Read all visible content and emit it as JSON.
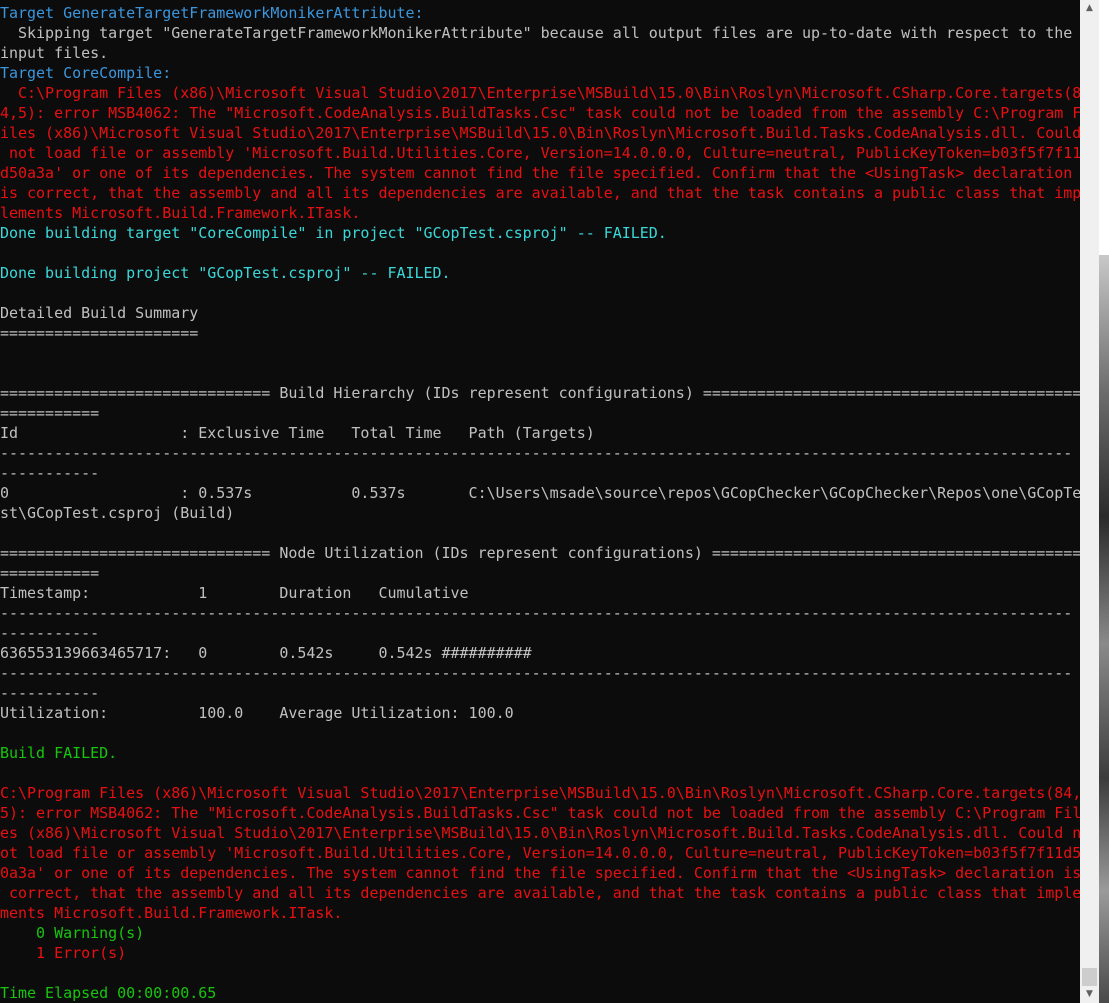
{
  "console": {
    "lines": [
      {
        "text": "Target GenerateTargetFrameworkMonikerAttribute:",
        "color": "#3a96dd"
      },
      {
        "text": "  Skipping target \"GenerateTargetFrameworkMonikerAttribute\" because all output files are up-to-date with respect to the",
        "color": "#c0c0c0"
      },
      {
        "text": "input files.",
        "color": "#c0c0c0"
      },
      {
        "text": "Target CoreCompile:",
        "color": "#3a96dd"
      },
      {
        "text": "  C:\\Program Files (x86)\\Microsoft Visual Studio\\2017\\Enterprise\\MSBuild\\15.0\\Bin\\Roslyn\\Microsoft.CSharp.Core.targets(8",
        "color": "#e81010"
      },
      {
        "text": "4,5): error MSB4062: The \"Microsoft.CodeAnalysis.BuildTasks.Csc\" task could not be loaded from the assembly C:\\Program F",
        "color": "#e81010"
      },
      {
        "text": "iles (x86)\\Microsoft Visual Studio\\2017\\Enterprise\\MSBuild\\15.0\\Bin\\Roslyn\\Microsoft.Build.Tasks.CodeAnalysis.dll. Could",
        "color": "#e81010"
      },
      {
        "text": " not load file or assembly 'Microsoft.Build.Utilities.Core, Version=14.0.0.0, Culture=neutral, PublicKeyToken=b03f5f7f11",
        "color": "#e81010"
      },
      {
        "text": "d50a3a' or one of its dependencies. The system cannot find the file specified. Confirm that the <UsingTask> declaration",
        "color": "#e81010"
      },
      {
        "text": "is correct, that the assembly and all its dependencies are available, and that the task contains a public class that imp",
        "color": "#e81010"
      },
      {
        "text": "lements Microsoft.Build.Framework.ITask.",
        "color": "#e81010"
      },
      {
        "text": "Done building target \"CoreCompile\" in project \"GCopTest.csproj\" -- FAILED.",
        "color": "#3ad8d8"
      },
      {
        "text": "",
        "color": "#c0c0c0"
      },
      {
        "text": "Done building project \"GCopTest.csproj\" -- FAILED.",
        "color": "#3ad8d8"
      },
      {
        "text": "",
        "color": "#c0c0c0"
      },
      {
        "text": "Detailed Build Summary",
        "color": "#c0c0c0"
      },
      {
        "text": "======================",
        "color": "#c0c0c0"
      },
      {
        "text": "",
        "color": "#c0c0c0"
      },
      {
        "text": "",
        "color": "#c0c0c0"
      },
      {
        "text": "============================== Build Hierarchy (IDs represent configurations) =====================================================",
        "color": "#c0c0c0"
      },
      {
        "text": "===========",
        "color": "#c0c0c0"
      },
      {
        "text": "Id                  : Exclusive Time   Total Time   Path (Targets)",
        "color": "#c0c0c0"
      },
      {
        "text": "-----------------------------------------------------------------------------------------------------------------------",
        "color": "#c0c0c0"
      },
      {
        "text": "-----------",
        "color": "#c0c0c0"
      },
      {
        "text": "0                   : 0.537s           0.537s       C:\\Users\\msade\\source\\repos\\GCopChecker\\GCopChecker\\Repos\\one\\GCopTe",
        "color": "#c0c0c0"
      },
      {
        "text": "st\\GCopTest.csproj (Build)",
        "color": "#c0c0c0"
      },
      {
        "text": "",
        "color": "#c0c0c0"
      },
      {
        "text": "============================== Node Utilization (IDs represent configurations) ====================================================",
        "color": "#c0c0c0"
      },
      {
        "text": "===========",
        "color": "#c0c0c0"
      },
      {
        "text": "Timestamp:            1        Duration   Cumulative",
        "color": "#c0c0c0"
      },
      {
        "text": "-----------------------------------------------------------------------------------------------------------------------",
        "color": "#c0c0c0"
      },
      {
        "text": "-----------",
        "color": "#c0c0c0"
      },
      {
        "text": "636553139663465717:   0        0.542s     0.542s ##########",
        "color": "#c0c0c0"
      },
      {
        "text": "-----------------------------------------------------------------------------------------------------------------------",
        "color": "#c0c0c0"
      },
      {
        "text": "-----------",
        "color": "#c0c0c0"
      },
      {
        "text": "Utilization:          100.0    Average Utilization: 100.0",
        "color": "#c0c0c0"
      },
      {
        "text": "",
        "color": "#c0c0c0"
      },
      {
        "text": "Build FAILED.",
        "color": "#16c60c"
      },
      {
        "text": "",
        "color": "#c0c0c0"
      },
      {
        "text": "C:\\Program Files (x86)\\Microsoft Visual Studio\\2017\\Enterprise\\MSBuild\\15.0\\Bin\\Roslyn\\Microsoft.CSharp.Core.targets(84,",
        "color": "#e81010"
      },
      {
        "text": "5): error MSB4062: The \"Microsoft.CodeAnalysis.BuildTasks.Csc\" task could not be loaded from the assembly C:\\Program Fil",
        "color": "#e81010"
      },
      {
        "text": "es (x86)\\Microsoft Visual Studio\\2017\\Enterprise\\MSBuild\\15.0\\Bin\\Roslyn\\Microsoft.Build.Tasks.CodeAnalysis.dll. Could n",
        "color": "#e81010"
      },
      {
        "text": "ot load file or assembly 'Microsoft.Build.Utilities.Core, Version=14.0.0.0, Culture=neutral, PublicKeyToken=b03f5f7f11d5",
        "color": "#e81010"
      },
      {
        "text": "0a3a' or one of its dependencies. The system cannot find the file specified. Confirm that the <UsingTask> declaration is",
        "color": "#e81010"
      },
      {
        "text": " correct, that the assembly and all its dependencies are available, and that the task contains a public class that imple",
        "color": "#e81010"
      },
      {
        "text": "ments Microsoft.Build.Framework.ITask.",
        "color": "#e81010"
      },
      {
        "text": "    0 Warning(s)",
        "color": "#16c60c"
      },
      {
        "text": "    1 Error(s)",
        "color": "#e81010"
      },
      {
        "text": "",
        "color": "#c0c0c0"
      },
      {
        "text": "Time Elapsed 00:00:00.65",
        "color": "#16c60c"
      }
    ]
  },
  "scrollbar": {
    "up_icon": "triangle-up-icon",
    "down_icon": "triangle-down-icon",
    "up_glyph": "▲",
    "down_glyph": "▼",
    "position": 1.0
  },
  "colors": {
    "background": "#0c0c0c",
    "default_text": "#c0c0c0",
    "target_blue": "#3a96dd",
    "done_cyan": "#3ad8d8",
    "error_red": "#e81010",
    "success_green": "#16c60c"
  }
}
